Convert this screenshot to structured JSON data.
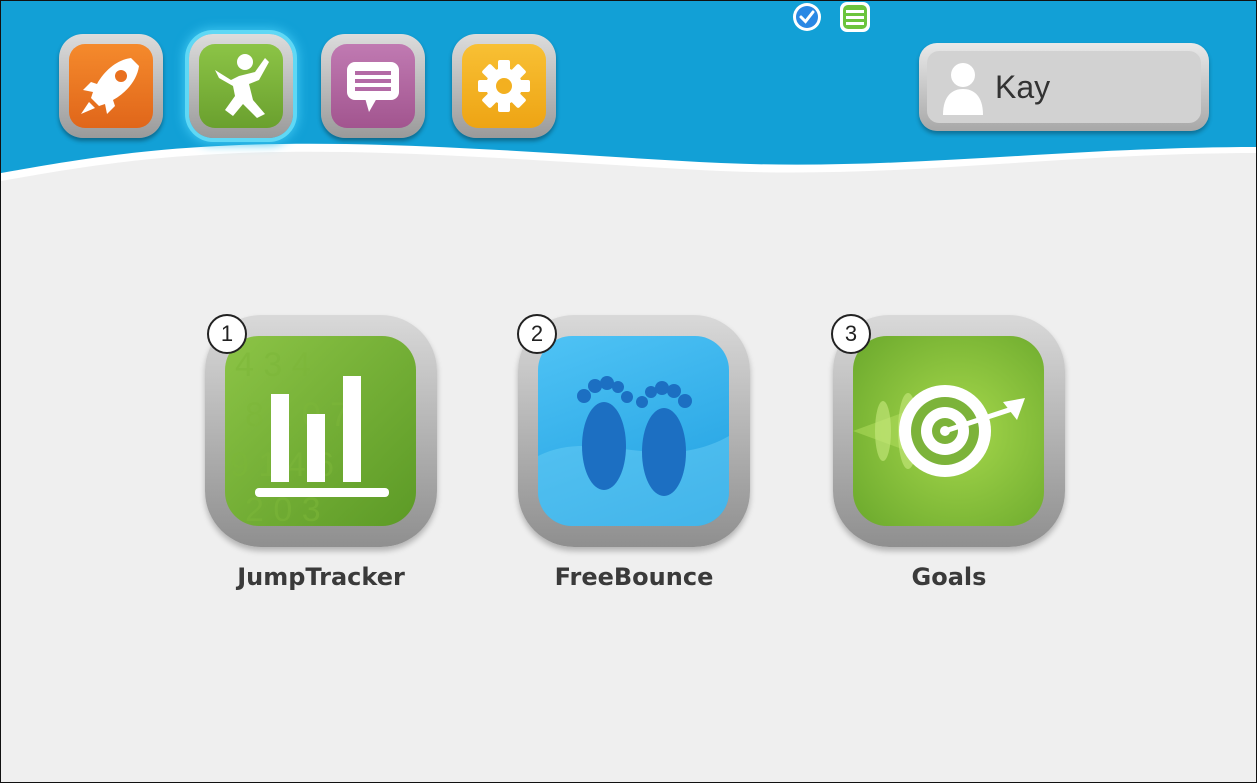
{
  "colors": {
    "header_blue": "#12a0d6",
    "background": "#efefef",
    "nav_orange": "#f07a1c",
    "nav_green": "#7cb33a",
    "nav_purple": "#b46aa6",
    "nav_yellow": "#f5b320",
    "check_blue": "#2a88e4",
    "list_green": "#6cc43c"
  },
  "nav": {
    "items": [
      {
        "icon": "rocket-icon",
        "active": false
      },
      {
        "icon": "jumping-person-icon",
        "active": true
      },
      {
        "icon": "chat-bubble-icon",
        "active": false
      },
      {
        "icon": "gear-icon",
        "active": false
      }
    ]
  },
  "status": {
    "icons": [
      "check-circle-icon",
      "list-icon"
    ]
  },
  "user": {
    "name": "Kay",
    "icon": "user-silhouette-icon"
  },
  "apps": [
    {
      "number": "1",
      "label": "JumpTracker",
      "icon": "bar-chart-icon"
    },
    {
      "number": "2",
      "label": "FreeBounce",
      "icon": "footprints-icon"
    },
    {
      "number": "3",
      "label": "Goals",
      "icon": "target-icon"
    }
  ]
}
